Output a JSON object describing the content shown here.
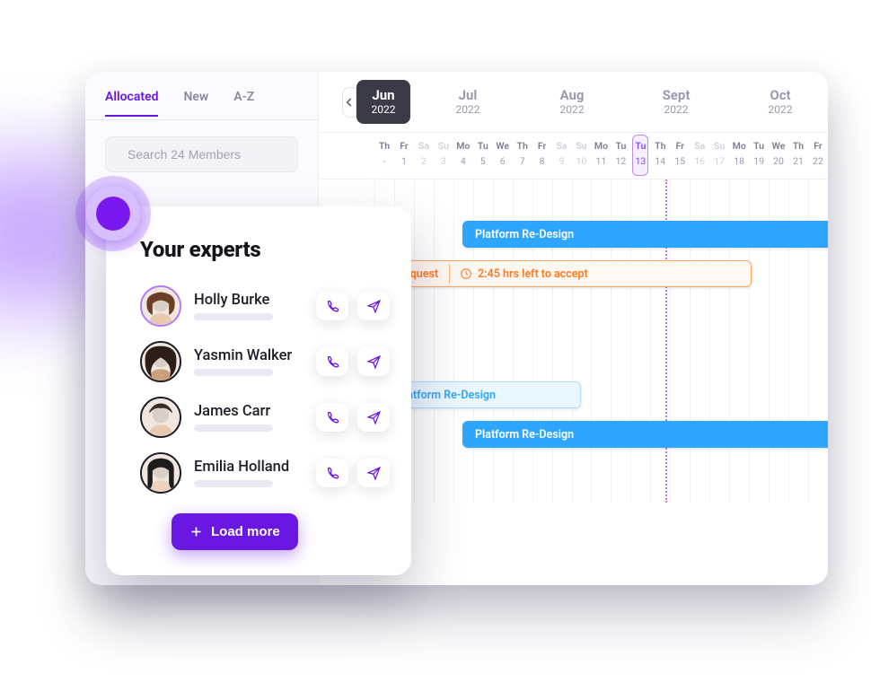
{
  "tabs": {
    "allocated": "Allocated",
    "new": "New",
    "az": "A-Z"
  },
  "search": {
    "placeholder": "Search 24 Members"
  },
  "timeline": {
    "months": [
      {
        "m": "Jun",
        "y": "2022",
        "active": true
      },
      {
        "m": "Jul",
        "y": "2022"
      },
      {
        "m": "Aug",
        "y": "2022"
      },
      {
        "m": "Sept",
        "y": "2022"
      },
      {
        "m": "Oct",
        "y": "2022"
      }
    ],
    "days": [
      {
        "dn": "Th",
        "dd": "-"
      },
      {
        "dn": "Fr",
        "dd": "1"
      },
      {
        "dn": "Sa",
        "dd": "2",
        "weekend": true
      },
      {
        "dn": "Su",
        "dd": "3",
        "weekend": true
      },
      {
        "dn": "Mo",
        "dd": "4"
      },
      {
        "dn": "Tu",
        "dd": "5"
      },
      {
        "dn": "We",
        "dd": "6"
      },
      {
        "dn": "Th",
        "dd": "7"
      },
      {
        "dn": "Fr",
        "dd": "8"
      },
      {
        "dn": "Sa",
        "dd": "9",
        "weekend": true
      },
      {
        "dn": "Su",
        "dd": "10",
        "weekend": true
      },
      {
        "dn": "Mo",
        "dd": "11"
      },
      {
        "dn": "Tu",
        "dd": "12"
      },
      {
        "dn": "Tu",
        "dd": "13",
        "today": true
      },
      {
        "dn": "Th",
        "dd": "14"
      },
      {
        "dn": "Fr",
        "dd": "15"
      },
      {
        "dn": "Sa",
        "dd": "16",
        "weekend": true
      },
      {
        "dn": "Su",
        "dd": "17",
        "weekend": true
      },
      {
        "dn": "Mo",
        "dd": "18"
      },
      {
        "dn": "Tu",
        "dd": "19"
      },
      {
        "dn": "We",
        "dd": "20"
      },
      {
        "dn": "Th",
        "dd": "21"
      },
      {
        "dn": "Fr",
        "dd": "22"
      }
    ],
    "bars": {
      "row1_label": "Platform Re-Design",
      "row2_prefix": "equest",
      "row2_label": "2:45 hrs left to accept",
      "row3_label": "latform Re-Design",
      "row4_label": "Platform Re-Design"
    }
  },
  "experts": {
    "title": "Your experts",
    "people": [
      {
        "name": "Holly Burke"
      },
      {
        "name": "Yasmin Walker"
      },
      {
        "name": "James Carr"
      },
      {
        "name": "Emilia Holland"
      }
    ],
    "loadmore": "Load more"
  }
}
